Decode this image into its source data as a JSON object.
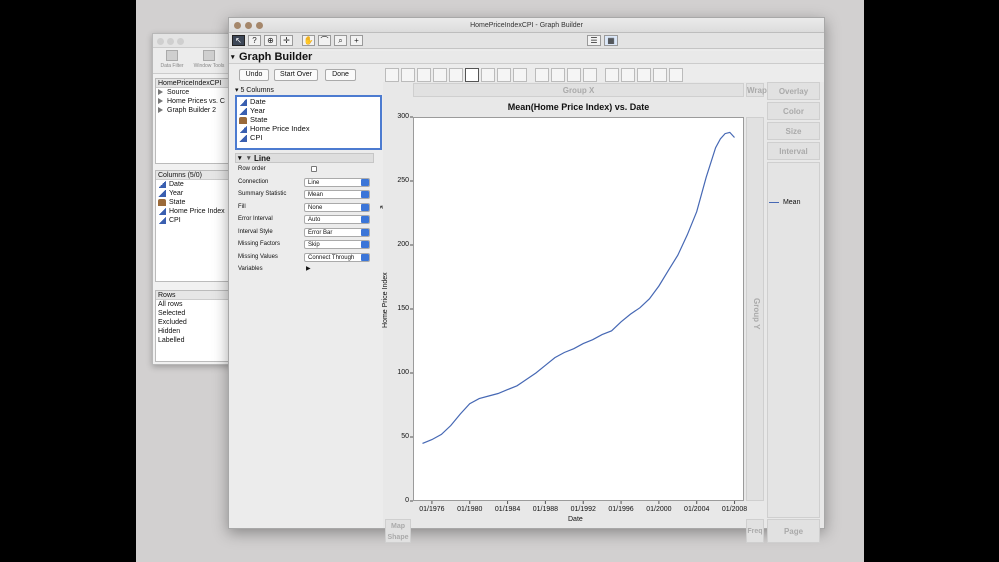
{
  "bgwin": {
    "tool_data_filter": "Data Filter",
    "tool_window_tools": "Window Tools",
    "table_title": "HomePriceIndexCPI",
    "table_items": [
      "Source",
      "Home Prices vs. C",
      "Graph Builder 2"
    ],
    "columns_header": "Columns (5/0)",
    "columns": [
      "Date",
      "Year",
      "State",
      "Home Price Index",
      "CPI"
    ],
    "rows_header": "Rows",
    "rows": [
      "All rows",
      "Selected",
      "Excluded",
      "Hidden",
      "Labelled"
    ]
  },
  "window": {
    "title": "HomePriceIndexCPI - Graph Builder",
    "header": "Graph Builder",
    "toolbar_icons": [
      "arrow-icon",
      "help-icon",
      "crosshair-icon",
      "move-icon",
      "hand-icon",
      "lasso-icon",
      "magnifier-icon",
      "annotate-icon"
    ]
  },
  "buttons": {
    "undo": "Undo",
    "start_over": "Start Over",
    "done": "Done"
  },
  "columns_panel": {
    "header": "5 Columns",
    "items": [
      "Date",
      "Year",
      "State",
      "Home Price Index",
      "CPI"
    ]
  },
  "line_panel": {
    "header": "Line",
    "rows": [
      {
        "label": "Row order",
        "type": "checkbox",
        "value": ""
      },
      {
        "label": "Connection",
        "type": "select",
        "value": "Line"
      },
      {
        "label": "Summary Statistic",
        "type": "select",
        "value": "Mean"
      },
      {
        "label": "Fill",
        "type": "select",
        "value": "None"
      },
      {
        "label": "Error Interval",
        "type": "select",
        "value": "Auto"
      },
      {
        "label": "Interval Style",
        "type": "select",
        "value": "Error Bar"
      },
      {
        "label": "Missing Factors",
        "type": "select",
        "value": "Skip"
      },
      {
        "label": "Missing Values",
        "type": "select",
        "value": "Connect Through"
      },
      {
        "label": "Variables",
        "type": "disclosure",
        "value": ""
      }
    ]
  },
  "zones": {
    "group_x": "Group X",
    "group_y": "Group Y",
    "wrap": "Wrap",
    "overlay": "Overlay",
    "color": "Color",
    "size": "Size",
    "interval": "Interval",
    "map_shape": "Map Shape",
    "freq": "Freq",
    "page": "Page"
  },
  "accent": "#4668b4",
  "chart_data": {
    "type": "line",
    "title": "Mean(Home Price Index) vs. Date",
    "xlabel": "Date",
    "ylabel": "Home Price Index",
    "ylim": [
      0,
      300
    ],
    "xlim": [
      1974.0,
      2009.0
    ],
    "yticks": [
      "0",
      "50",
      "100",
      "150",
      "200",
      "250",
      "300"
    ],
    "xticks": [
      "01/1976",
      "01/1980",
      "01/1984",
      "01/1988",
      "01/1992",
      "01/1996",
      "01/2000",
      "01/2004",
      "01/2008"
    ],
    "legend": {
      "position": "right",
      "entries": [
        "Mean"
      ]
    },
    "series": [
      {
        "name": "Mean",
        "x": [
          1975.0,
          1976.0,
          1977.0,
          1978.0,
          1979.0,
          1980.0,
          1981.0,
          1982.0,
          1983.0,
          1984.0,
          1985.0,
          1986.0,
          1987.0,
          1988.0,
          1989.0,
          1990.0,
          1991.0,
          1992.0,
          1993.0,
          1994.0,
          1995.0,
          1996.0,
          1997.0,
          1998.0,
          1999.0,
          2000.0,
          2001.0,
          2002.0,
          2003.0,
          2004.0,
          2005.0,
          2006.0,
          2006.5,
          2007.0,
          2007.5,
          2008.0
        ],
        "y": [
          45,
          48,
          52,
          59,
          68,
          76,
          80,
          82,
          84,
          87,
          90,
          95,
          100,
          106,
          112,
          116,
          119,
          123,
          126,
          130,
          133,
          140,
          146,
          151,
          158,
          168,
          180,
          192,
          208,
          226,
          253,
          276,
          283,
          287,
          288,
          284
        ]
      }
    ]
  }
}
